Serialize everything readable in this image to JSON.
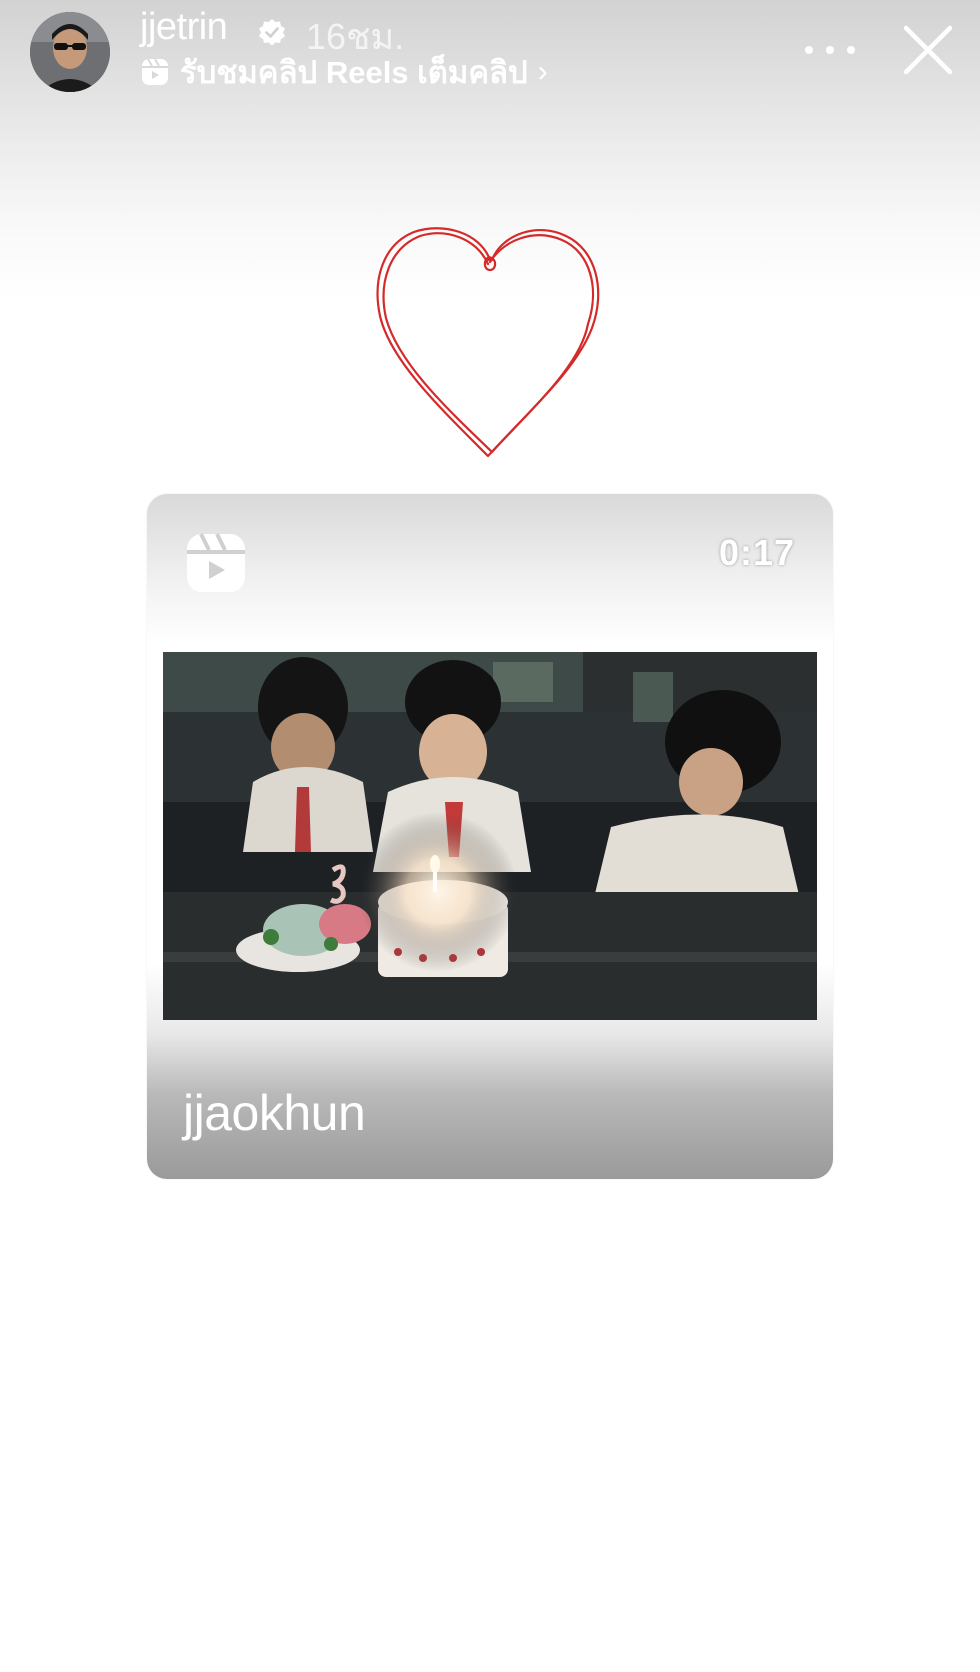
{
  "story": {
    "username": "jjetrin",
    "time_ago": "16ชม.",
    "reels_link_text": "รับชมคลิป Reels เต็มคลิป",
    "icons": {
      "verified": "verified-badge-icon",
      "reels": "reels-icon",
      "chevron": "chevron-right-icon",
      "more": "more-options-icon",
      "close": "close-icon"
    }
  },
  "sticker": {
    "heart_color": "#d42a2a"
  },
  "reel_card": {
    "duration": "0:17",
    "author": "jjaokhun"
  }
}
